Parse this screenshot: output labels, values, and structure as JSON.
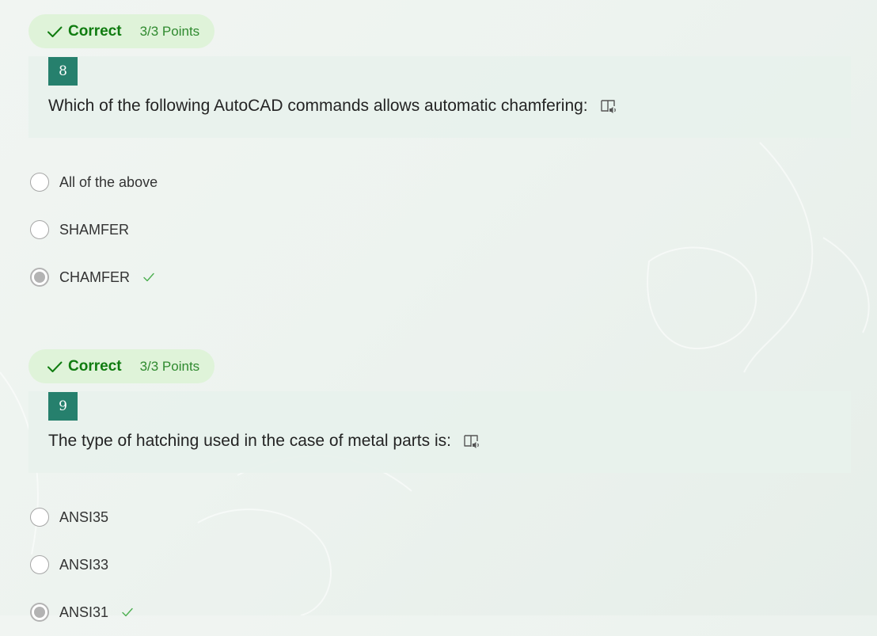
{
  "colors": {
    "correct_green": "#107c10",
    "badge_bg": "#dff3d9",
    "question_number_bg": "#26806d",
    "check_light": "#4caf50"
  },
  "questions": [
    {
      "status": "Correct",
      "points": "3/3 Points",
      "number": "8",
      "text": "Which of the following AutoCAD commands allows automatic chamfering:",
      "options": [
        {
          "label": "All of the above",
          "selected": false,
          "correct": false
        },
        {
          "label": "SHAMFER",
          "selected": false,
          "correct": false
        },
        {
          "label": "CHAMFER",
          "selected": true,
          "correct": true
        }
      ]
    },
    {
      "status": "Correct",
      "points": "3/3 Points",
      "number": "9",
      "text": "The type of hatching used in the case of metal parts is:",
      "options": [
        {
          "label": "ANSI35",
          "selected": false,
          "correct": false
        },
        {
          "label": "ANSI33",
          "selected": false,
          "correct": false
        },
        {
          "label": "ANSI31",
          "selected": true,
          "correct": true
        }
      ]
    }
  ]
}
